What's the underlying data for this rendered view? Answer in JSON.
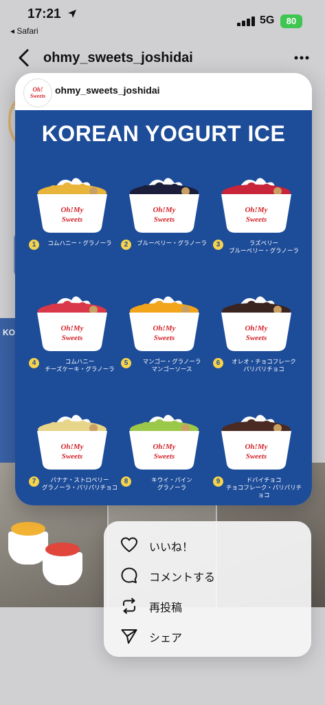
{
  "status_bar": {
    "time": "17:21",
    "back_app": "◂ Safari",
    "network": "5G",
    "battery": "80"
  },
  "nav": {
    "title": "ohmy_sweets_joshidai"
  },
  "background_page": {
    "thumb_text": "KO"
  },
  "preview": {
    "username": "ohmy_sweets_joshidai",
    "headline": "KOREAN YOGURT ICE",
    "items": [
      {
        "num": "1",
        "label": "コムハニー・グラノーラ",
        "topping": "#e9b43a"
      },
      {
        "num": "2",
        "label": "ブルーベリー・グラノーラ",
        "topping": "#1b1e3a"
      },
      {
        "num": "3",
        "label": "ラズベリー\nブルーベリー・グラノーラ",
        "topping": "#c8243a"
      },
      {
        "num": "4",
        "label": "コムハニー\nチーズケーキ・グラノーラ",
        "topping": "#d8384a"
      },
      {
        "num": "5",
        "label": "マンゴー・グラノーラ\nマンゴーソース",
        "topping": "#f2a51b"
      },
      {
        "num": "6",
        "label": "オレオ・チョコフレーク\nパリパリチョコ",
        "topping": "#3a2420"
      },
      {
        "num": "7",
        "label": "バナナ・ストロベリー\nグラノーラ・パリパリチョコ",
        "topping": "#e7d58a"
      },
      {
        "num": "8",
        "label": "キウイ・パイン\nグラノーラ",
        "topping": "#9cc84a"
      },
      {
        "num": "9",
        "label": "ドバイチョコ\nチョコフレーク・パリパリチョコ",
        "topping": "#4a2a22"
      }
    ]
  },
  "menu": {
    "items": [
      {
        "label": "いいね！",
        "icon": "heart-icon"
      },
      {
        "label": "コメントする",
        "icon": "comment-icon"
      },
      {
        "label": "再投稿",
        "icon": "repost-icon"
      },
      {
        "label": "シェア",
        "icon": "share-icon"
      }
    ]
  },
  "colors": {
    "poster_blue": "#1d4c99",
    "number_badge": "#f6d34a",
    "battery_green": "#3fc552",
    "brand_red": "#d2232a"
  }
}
